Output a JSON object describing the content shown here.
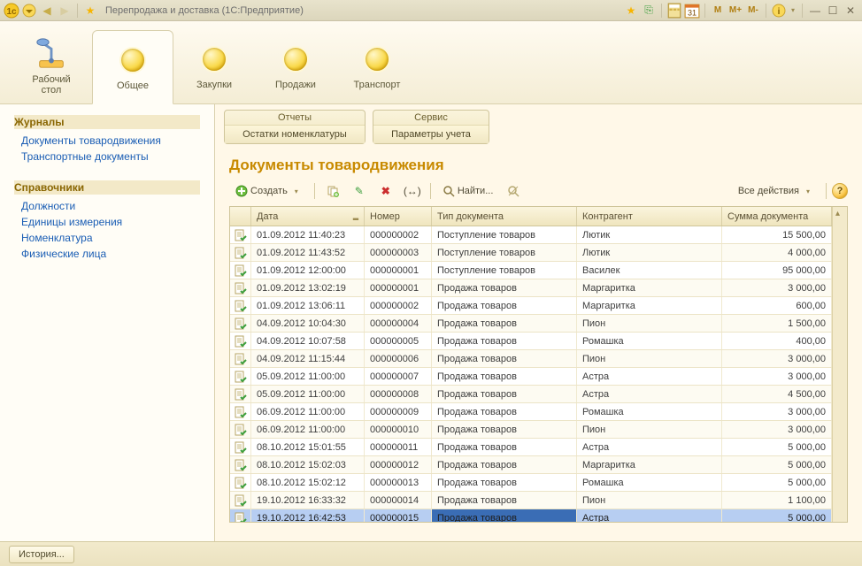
{
  "app": {
    "title": "Перепродажа и доставка  (1С:Предприятие)"
  },
  "memory_buttons": {
    "m": "M",
    "mplus": "M+",
    "mminus": "M-"
  },
  "sections": [
    {
      "label": "Рабочий\nстол",
      "icon": "desktop-lamp",
      "active": false
    },
    {
      "label": "Общее",
      "icon": "coin",
      "active": true
    },
    {
      "label": "Закупки",
      "icon": "coin",
      "active": false
    },
    {
      "label": "Продажи",
      "icon": "coin",
      "active": false
    },
    {
      "label": "Транспорт",
      "icon": "coin",
      "active": false
    }
  ],
  "sidebar": {
    "groups": [
      {
        "title": "Журналы",
        "items": [
          "Документы товародвижения",
          "Транспортные документы"
        ]
      },
      {
        "title": "Справочники",
        "items": [
          "Должности",
          "Единицы измерения",
          "Номенклатура",
          "Физические лица"
        ]
      }
    ]
  },
  "panels": [
    {
      "title": "Отчеты",
      "button": "Остатки номенклатуры"
    },
    {
      "title": "Сервис",
      "button": "Параметры учета"
    }
  ],
  "page_title": "Документы товародвижения",
  "toolbar": {
    "create": "Создать",
    "find": "Найти...",
    "all_actions": "Все действия"
  },
  "table": {
    "columns": {
      "date": "Дата",
      "number": "Номер",
      "doctype": "Тип документа",
      "contractor": "Контрагент",
      "sum": "Сумма документа"
    },
    "rows": [
      {
        "date": "01.09.2012 11:40:23",
        "number": "000000002",
        "doctype": "Поступление товаров",
        "contractor": "Лютик",
        "sum": "15 500,00"
      },
      {
        "date": "01.09.2012 11:43:52",
        "number": "000000003",
        "doctype": "Поступление товаров",
        "contractor": "Лютик",
        "sum": "4 000,00"
      },
      {
        "date": "01.09.2012 12:00:00",
        "number": "000000001",
        "doctype": "Поступление товаров",
        "contractor": "Василек",
        "sum": "95 000,00"
      },
      {
        "date": "01.09.2012 13:02:19",
        "number": "000000001",
        "doctype": "Продажа товаров",
        "contractor": "Маргаритка",
        "sum": "3 000,00"
      },
      {
        "date": "01.09.2012 13:06:11",
        "number": "000000002",
        "doctype": "Продажа товаров",
        "contractor": "Маргаритка",
        "sum": "600,00"
      },
      {
        "date": "04.09.2012 10:04:30",
        "number": "000000004",
        "doctype": "Продажа товаров",
        "contractor": "Пион",
        "sum": "1 500,00"
      },
      {
        "date": "04.09.2012 10:07:58",
        "number": "000000005",
        "doctype": "Продажа товаров",
        "contractor": "Ромашка",
        "sum": "400,00"
      },
      {
        "date": "04.09.2012 11:15:44",
        "number": "000000006",
        "doctype": "Продажа товаров",
        "contractor": "Пион",
        "sum": "3 000,00"
      },
      {
        "date": "05.09.2012 11:00:00",
        "number": "000000007",
        "doctype": "Продажа товаров",
        "contractor": "Астра",
        "sum": "3 000,00"
      },
      {
        "date": "05.09.2012 11:00:00",
        "number": "000000008",
        "doctype": "Продажа товаров",
        "contractor": "Астра",
        "sum": "4 500,00"
      },
      {
        "date": "06.09.2012 11:00:00",
        "number": "000000009",
        "doctype": "Продажа товаров",
        "contractor": "Ромашка",
        "sum": "3 000,00"
      },
      {
        "date": "06.09.2012 11:00:00",
        "number": "000000010",
        "doctype": "Продажа товаров",
        "contractor": "Пион",
        "sum": "3 000,00"
      },
      {
        "date": "08.10.2012 15:01:55",
        "number": "000000011",
        "doctype": "Продажа товаров",
        "contractor": "Астра",
        "sum": "5 000,00"
      },
      {
        "date": "08.10.2012 15:02:03",
        "number": "000000012",
        "doctype": "Продажа товаров",
        "contractor": "Маргаритка",
        "sum": "5 000,00"
      },
      {
        "date": "08.10.2012 15:02:12",
        "number": "000000013",
        "doctype": "Продажа товаров",
        "contractor": "Ромашка",
        "sum": "5 000,00"
      },
      {
        "date": "19.10.2012 16:33:32",
        "number": "000000014",
        "doctype": "Продажа товаров",
        "contractor": "Пион",
        "sum": "1 100,00"
      },
      {
        "date": "19.10.2012 16:42:53",
        "number": "000000015",
        "doctype": "Продажа товаров",
        "contractor": "Астра",
        "sum": "5 000,00",
        "selected": true
      }
    ]
  },
  "statusbar": {
    "history": "История..."
  }
}
